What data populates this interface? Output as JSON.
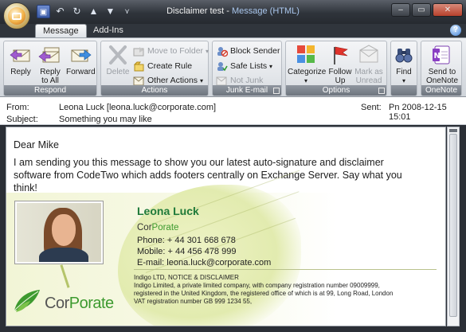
{
  "window": {
    "title_main": "Disclaimer test - ",
    "title_accent": "Message (HTML)",
    "controls": [
      "–",
      "▭",
      "✕"
    ]
  },
  "quick_access": [
    "save",
    "undo",
    "redo",
    "previous",
    "next",
    "customize"
  ],
  "tabs": [
    {
      "label": "Message",
      "active": true
    },
    {
      "label": "Add-Ins",
      "active": false
    }
  ],
  "help_label": "?",
  "ribbon": {
    "respond": {
      "label": "Respond",
      "reply": "Reply",
      "reply_all_1": "Reply",
      "reply_all_2": "to All",
      "forward": "Forward"
    },
    "actions": {
      "label": "Actions",
      "delete": "Delete",
      "move_to_folder": "Move to Folder",
      "create_rule": "Create Rule",
      "other_actions": "Other Actions"
    },
    "junk": {
      "label": "Junk E-mail",
      "block_sender": "Block Sender",
      "safe_lists": "Safe Lists",
      "not_junk": "Not Junk"
    },
    "options": {
      "label": "Options",
      "categorize": "Categorize",
      "follow_1": "Follow",
      "follow_2": "Up",
      "mark_1": "Mark as",
      "mark_2": "Unread"
    },
    "find": {
      "label": "",
      "find": "Find"
    },
    "onenote": {
      "label": "OneNote",
      "send_1": "Send to",
      "send_2": "OneNote"
    }
  },
  "header": {
    "from_label": "From:",
    "from_value": "Leona Luck [leona.luck@corporate.com]",
    "sent_label": "Sent:",
    "sent_value": "Pn 2008-12-15 15:01",
    "subject_label": "Subject:",
    "subject_value": "Something you may like"
  },
  "message": {
    "greeting": "Dear Mike",
    "paragraph": "I am sending you this message to show you our latest auto-signature and disclaimer software from CodeTwo which adds footers centrally on Exchange Server. Say what you think!"
  },
  "signature": {
    "name": "Leona Luck",
    "company_1": "Cor",
    "company_2": "Porate",
    "phone": "Phone: + 44 301 668 678",
    "mobile": "Mobile:  + 44 456 478 999",
    "email": "E-mail: leona.luck@corporate.com",
    "legal_title": "Indigo LTD, NOTICE & DISCLAIMER",
    "legal_1": "Indigo Limited, a private limited company, with company registration number 09009999,",
    "legal_2": "registered in the United Kingdom, the registered office of which is at 99, Long Road, London",
    "legal_3": "VAT registration number GB 999 1234 55,",
    "logo_1": "Cor",
    "logo_2": "Porate"
  },
  "colors": {
    "brand_green": "#3d9a2f",
    "name_green": "#1f7a3a",
    "ribbon_label": "#6e757e"
  }
}
